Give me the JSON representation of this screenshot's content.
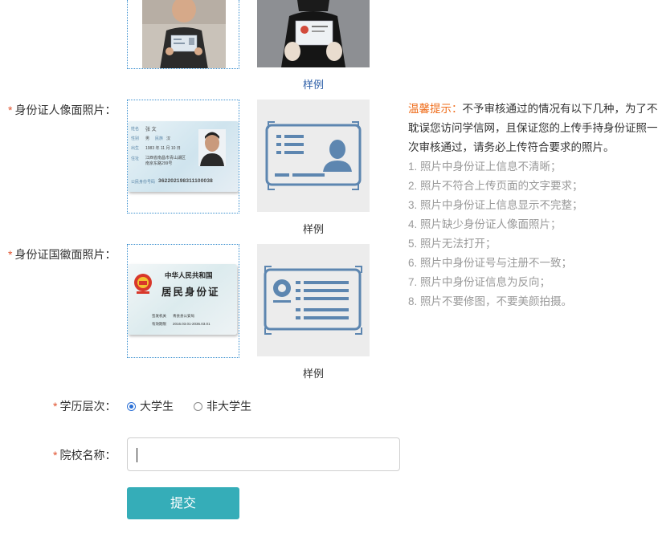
{
  "top_row": {
    "sample_caption": "样例"
  },
  "portrait": {
    "required_mark": "*",
    "label": "身份证人像面照片：",
    "sample_caption": "样例",
    "card": {
      "name_label": "姓名",
      "name_value": "张 文",
      "gender_label": "性别",
      "gender_value": "男",
      "ethnicity_label": "民族",
      "ethnicity_value": "汉",
      "birth_label": "出生",
      "birth_value": "1983 年 11 月 10 日",
      "address_label": "住址",
      "address_value": "江西省南昌市青山湖区南京东路299号",
      "id_label": "公民身份号码",
      "id_value": "362202198311100038"
    }
  },
  "emblem": {
    "required_mark": "*",
    "label": "身份证国徽面照片：",
    "sample_caption": "样例",
    "card": {
      "country": "中华人民共和国",
      "title": "居民身份证",
      "issuer_label": "签发机关",
      "issuer_value": "青县县公安局",
      "valid_label": "有效期限",
      "valid_value": "2016.03.01-2036.03.01"
    }
  },
  "tips": {
    "title": "温馨提示：",
    "main": "不予审核通过的情况有以下几种，为了不耽误您访问学信网，且保证您的上传手持身份证照一次审核通过，请务必上传符合要求的照片。",
    "items": [
      "1. 照片中身份证上信息不清晰；",
      "2. 照片不符合上传页面的文字要求；",
      "3. 照片中身份证上信息显示不完整；",
      "4. 照片缺少身份证人像面照片；",
      "5. 照片无法打开；",
      "6. 照片中身份证号与注册不一致；",
      "7. 照片中身份证信息为反向；",
      "8. 照片不要修图，不要美颜拍摄。"
    ]
  },
  "education": {
    "required_mark": "*",
    "label": "学历层次：",
    "options": [
      {
        "label": "大学生",
        "selected": true
      },
      {
        "label": "非大学生",
        "selected": false
      }
    ]
  },
  "school": {
    "required_mark": "*",
    "label": "院校名称：",
    "value": ""
  },
  "submit": {
    "label": "提交"
  },
  "colors": {
    "accent": "#35adb8",
    "required": "#e0522e",
    "tips_title": "#ef6c1a",
    "sample_link": "#2d5fa8",
    "icon_blue": "#5d86b0"
  }
}
